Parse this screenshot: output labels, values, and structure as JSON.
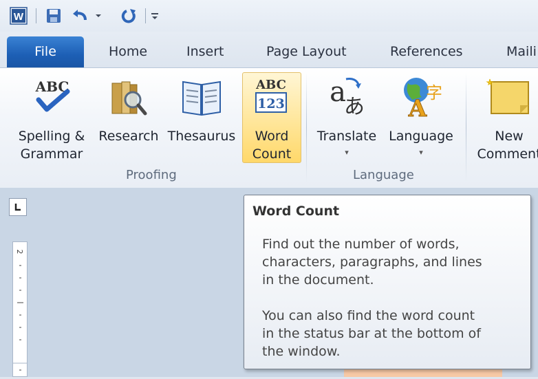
{
  "app": {
    "name": "Microsoft Word"
  },
  "quick_access": {
    "app_icon": "word-app-icon",
    "buttons": [
      "save-icon",
      "undo-icon",
      "undo-dropdown-icon",
      "redo-icon",
      "customize-qat-icon"
    ]
  },
  "tabs": [
    {
      "label": "File",
      "active": true
    },
    {
      "label": "Home"
    },
    {
      "label": "Insert"
    },
    {
      "label": "Page Layout"
    },
    {
      "label": "References"
    },
    {
      "label": "Maili"
    }
  ],
  "ribbon": {
    "groups": [
      {
        "label": "Proofing",
        "buttons": [
          {
            "line1": "Spelling &",
            "line2": "Grammar",
            "icon": "spelling-check-icon"
          },
          {
            "line1": "Research",
            "line2": "",
            "icon": "research-book-magnifier-icon"
          },
          {
            "line1": "Thesaurus",
            "line2": "",
            "icon": "thesaurus-book-icon"
          },
          {
            "line1": "Word",
            "line2": "Count",
            "icon": "abc-123-icon",
            "highlighted": true
          }
        ]
      },
      {
        "label": "Language",
        "buttons": [
          {
            "line1": "Translate",
            "line2": "▾",
            "icon": "translate-icon"
          },
          {
            "line1": "Language",
            "line2": "▾",
            "icon": "language-globe-icon"
          }
        ]
      },
      {
        "label": "",
        "buttons": [
          {
            "line1": "New",
            "line2": "Comment",
            "icon": "new-comment-icon"
          }
        ]
      }
    ],
    "icon_text": {
      "abc": "ABC",
      "abc_top": "ABC",
      "num": "123",
      "translate_a": "a",
      "translate_jp": "あ"
    }
  },
  "tooltip": {
    "title": "Word Count",
    "para1": "Find out the number of words,\ncharacters, paragraphs, and lines\nin the document.",
    "para2": "You can also find the word count\nin the status bar at the bottom of\nthe window."
  },
  "colors": {
    "file_tab": "#1d5fb5",
    "highlight": "#ffe69a",
    "tooltip_border": "#77808d"
  }
}
